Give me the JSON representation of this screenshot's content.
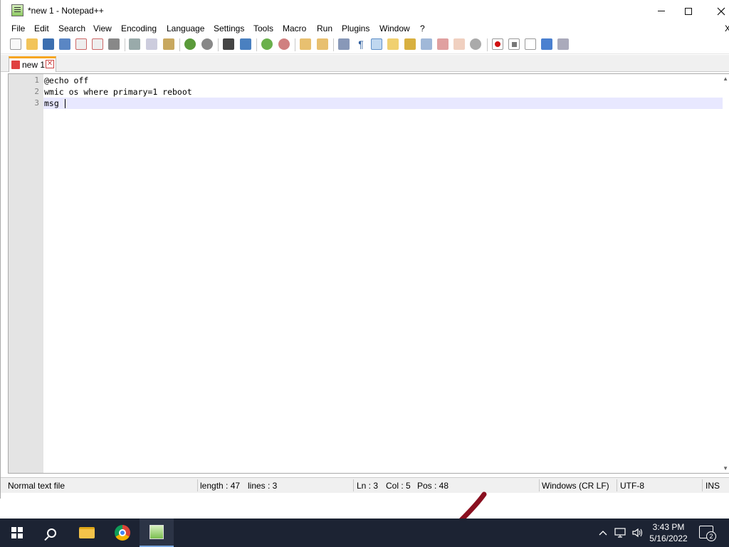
{
  "window": {
    "title": "*new 1 - Notepad++"
  },
  "menu": {
    "items": [
      "File",
      "Edit",
      "Search",
      "View",
      "Encoding",
      "Language",
      "Settings",
      "Tools",
      "Macro",
      "Run",
      "Plugins",
      "Window",
      "?"
    ],
    "close_glyph": "X"
  },
  "toolbar": {
    "icons": [
      "new-file-icon",
      "open-file-icon",
      "save-icon",
      "save-all-icon",
      "close-icon",
      "close-all-icon",
      "print-icon",
      "cut-icon",
      "copy-icon",
      "paste-icon",
      "undo-icon",
      "redo-icon",
      "find-icon",
      "replace-icon",
      "zoom-in-icon",
      "zoom-out-icon",
      "sync-vertical-icon",
      "sync-horizontal-icon",
      "word-wrap-icon",
      "show-all-chars-icon",
      "indent-guide-icon",
      "udl-icon",
      "doc-map-icon",
      "function-list-icon",
      "folder-as-workspace-icon",
      "monitoring-icon",
      "record-macro-icon",
      "stop-recording-icon",
      "playback-macro-icon",
      "run-macro-multiple-icon",
      "save-macro-icon"
    ]
  },
  "tabs": [
    {
      "label": "new 1",
      "modified": true
    }
  ],
  "editor": {
    "lines": [
      {
        "number": "1",
        "text": "@echo off"
      },
      {
        "number": "2",
        "text": "wmic os where primary=1 reboot"
      },
      {
        "number": "3",
        "text": "msg "
      }
    ],
    "current_line": 3
  },
  "status": {
    "file_type": "Normal text file",
    "length": "length : 47",
    "lines": "lines : 3",
    "ln": "Ln : 3",
    "col": "Col : 5",
    "pos": "Pos : 48",
    "eol": "Windows (CR LF)",
    "encoding": "UTF-8",
    "mode": "INS"
  },
  "taskbar": {
    "apps": [
      "start-icon",
      "search-icon",
      "file-explorer-icon",
      "chrome-icon",
      "notepad-plus-plus-icon"
    ],
    "time": "3:43 PM",
    "date": "5/16/2022",
    "notification_count": "2"
  },
  "colors": {
    "current_line": "#e8e8ff",
    "tab_accent": "#f6a623",
    "taskbar": "#1c2333"
  }
}
